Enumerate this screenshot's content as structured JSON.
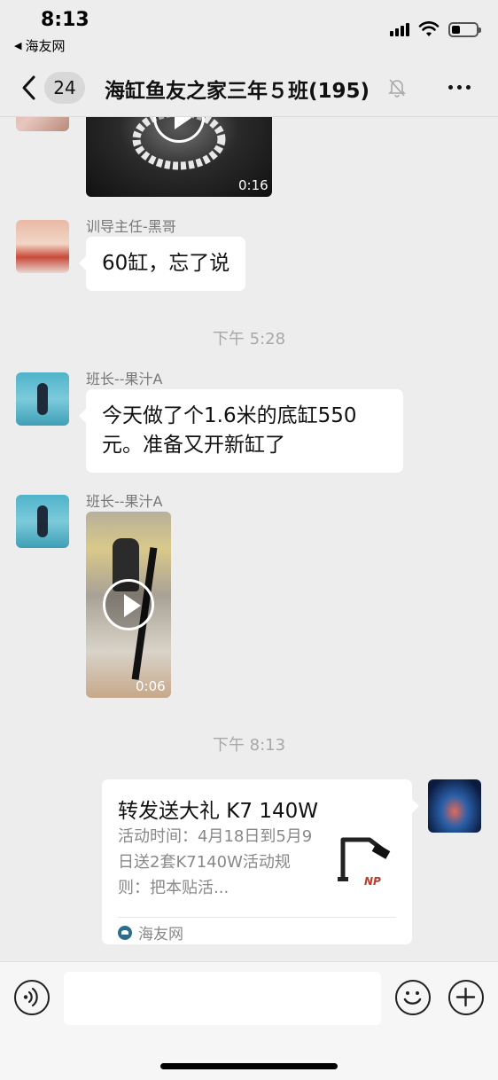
{
  "status_bar": {
    "time": "8:13",
    "back_app": "海友网"
  },
  "nav": {
    "unread_count": "24",
    "title": "海缸鱼友之家三年５班(195)"
  },
  "messages": [
    {
      "type": "video",
      "duration": "0:16"
    },
    {
      "type": "text",
      "sender": "训导主任-黑哥",
      "text": "60缸，忘了说"
    },
    {
      "type": "timestamp",
      "text": "下午 5:28"
    },
    {
      "type": "text",
      "sender": "班长--果汁A",
      "text": "今天做了个1.6米的底缸550元。准备又开新缸了"
    },
    {
      "type": "video",
      "sender": "班长--果汁A",
      "duration": "0:06"
    },
    {
      "type": "timestamp",
      "text": "下午 8:13"
    },
    {
      "type": "link_card",
      "title": "转发送大礼 K7 140W",
      "description": "活动时间：4月18日到5月9日送2套K7140W活动规则：把本贴活...",
      "thumbnail_brand": "NP",
      "source": "海友网"
    }
  ],
  "icons": {
    "back": "chevron-left-icon",
    "mute": "bell-muted-icon",
    "more": "more-dots-icon",
    "voice": "voice-icon",
    "emoji": "emoji-icon",
    "plus": "plus-icon"
  },
  "colors": {
    "background": "#ededed",
    "bubble": "#ffffff",
    "timestamp": "#a8a8a8",
    "sender": "#777777"
  }
}
